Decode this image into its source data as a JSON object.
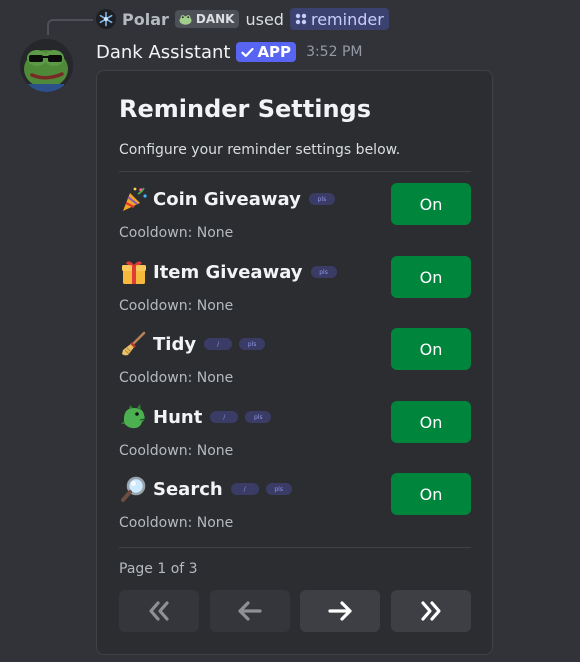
{
  "reply": {
    "username": "Polar",
    "tag": "DANK",
    "used_text": "used",
    "command": "reminder"
  },
  "message": {
    "author": "Dank Assistant",
    "badge": "APP",
    "timestamp": "3:52 PM"
  },
  "embed": {
    "title": "Reminder Settings",
    "description": "Configure your reminder settings below.",
    "items": [
      {
        "emoji": "party-popper-icon",
        "name": "Coin Giveaway",
        "cooldown": "Cooldown: None",
        "button": "On",
        "tags": [
          "pls"
        ]
      },
      {
        "emoji": "gift-icon",
        "name": "Item Giveaway",
        "cooldown": "Cooldown: None",
        "button": "On",
        "tags": [
          "pls"
        ]
      },
      {
        "emoji": "broom-icon",
        "name": "Tidy",
        "cooldown": "Cooldown: None",
        "button": "On",
        "tags": [
          "/",
          "pls"
        ]
      },
      {
        "emoji": "dragon-icon",
        "name": "Hunt",
        "cooldown": "Cooldown: None",
        "button": "On",
        "tags": [
          "/",
          "pls"
        ]
      },
      {
        "emoji": "magnifier-icon",
        "name": "Search",
        "cooldown": "Cooldown: None",
        "button": "On",
        "tags": [
          "/",
          "pls"
        ]
      }
    ],
    "page_label": "Page 1 of 3"
  },
  "pagination": {
    "first": "double-chevron-left-icon",
    "prev": "arrow-left-icon",
    "next": "arrow-right-icon",
    "last": "double-chevron-right-icon",
    "first_disabled": true,
    "prev_disabled": true
  },
  "colors": {
    "background": "#313338",
    "card": "#2b2d31",
    "on_button": "#00853d",
    "app_badge": "#5865f2"
  }
}
